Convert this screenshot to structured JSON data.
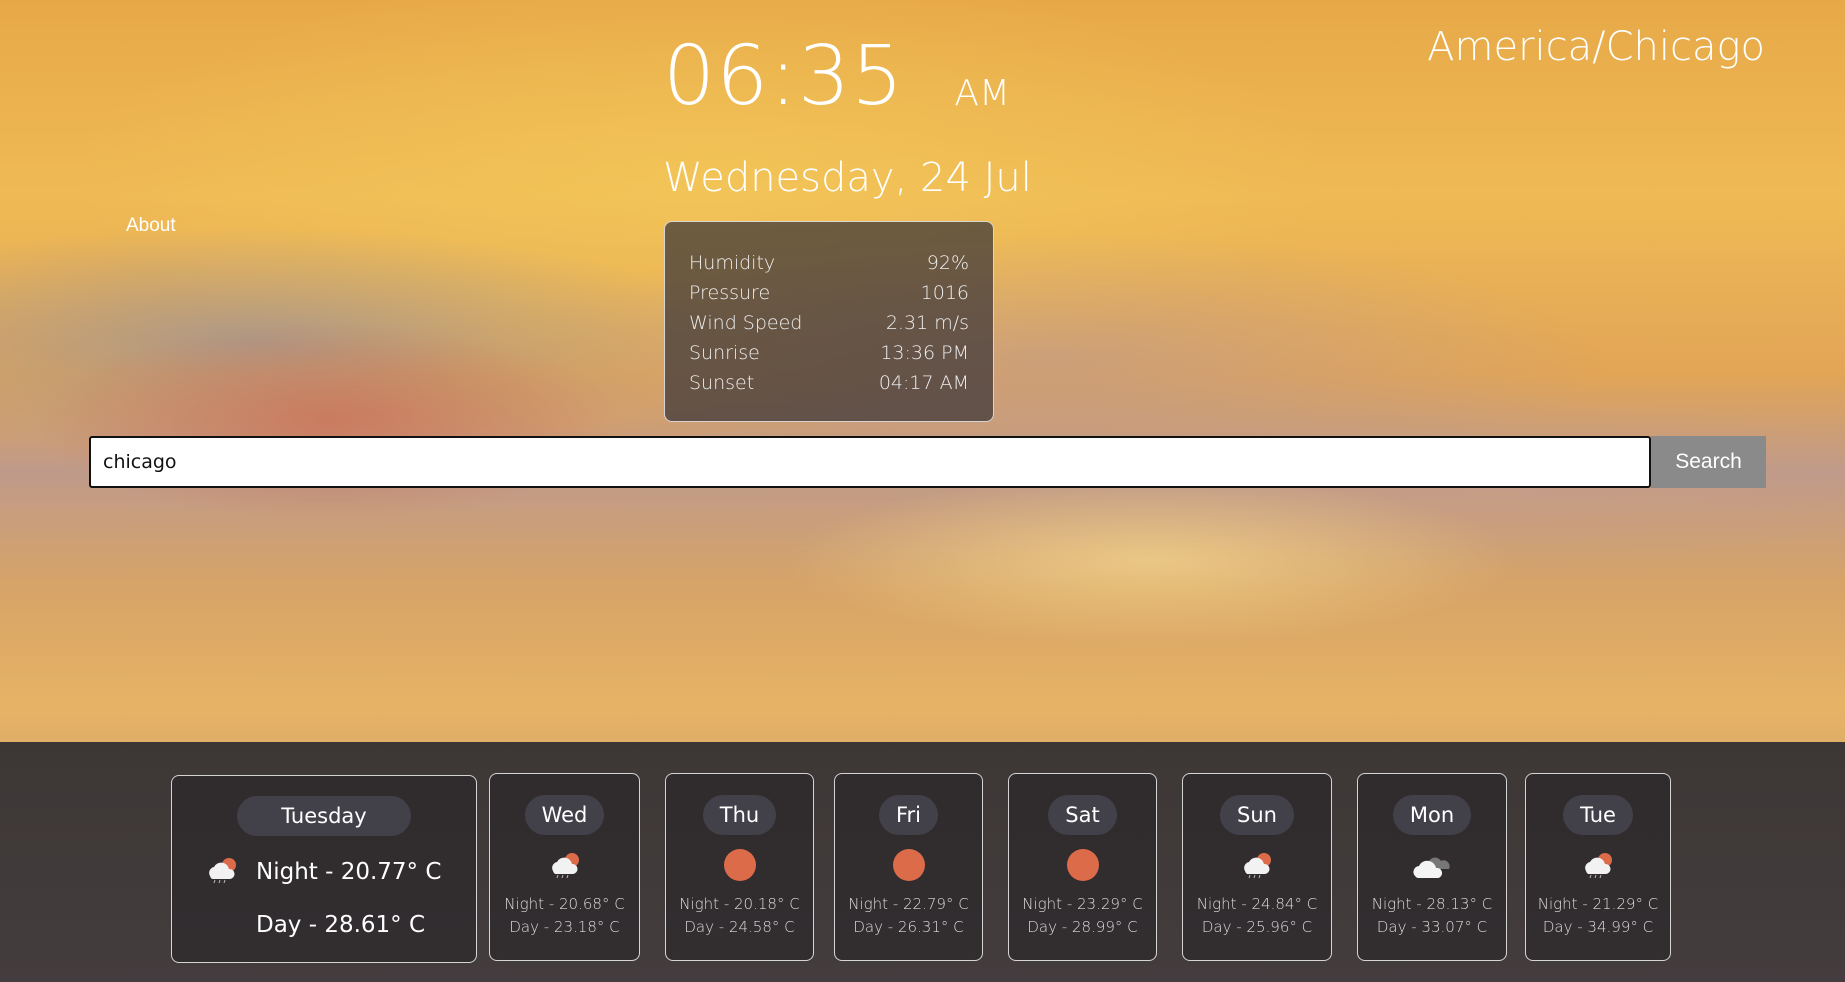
{
  "clock": {
    "time": "06:35",
    "ampm": "AM"
  },
  "date": "Wednesday, 24 Jul",
  "timezone": "America/Chicago",
  "nav": {
    "about": "About"
  },
  "stats": [
    {
      "label": "Humidity",
      "value": "92%"
    },
    {
      "label": "Pressure",
      "value": "1016"
    },
    {
      "label": "Wind Speed",
      "value": "2.31 m/s"
    },
    {
      "label": "Sunrise",
      "value": "13:36 PM"
    },
    {
      "label": "Sunset",
      "value": "04:17 AM"
    }
  ],
  "search": {
    "value": "chicago",
    "button": "Search"
  },
  "colors": {
    "sun": "#dc6b4a",
    "pill": "#42414a",
    "search_button": "#8a8a8a"
  },
  "today": {
    "day": "Tuesday",
    "icon": "cloud-sun-rain-icon",
    "night": "Night - 20.77° C",
    "day_temp": "Day - 28.61° C"
  },
  "forecast": [
    {
      "day": "Wed",
      "icon": "cloud-sun-rain-icon",
      "night": "Night - 20.68° C",
      "day_temp": "Day - 23.18° C"
    },
    {
      "day": "Thu",
      "icon": "sun-icon",
      "night": "Night - 20.18° C",
      "day_temp": "Day - 24.58° C"
    },
    {
      "day": "Fri",
      "icon": "sun-icon",
      "night": "Night - 22.79° C",
      "day_temp": "Day - 26.31° C"
    },
    {
      "day": "Sat",
      "icon": "sun-icon",
      "night": "Night - 23.29° C",
      "day_temp": "Day - 28.99° C"
    },
    {
      "day": "Sun",
      "icon": "cloud-sun-rain-icon",
      "night": "Night - 24.84° C",
      "day_temp": "Day - 25.96° C"
    },
    {
      "day": "Mon",
      "icon": "clouds-icon",
      "night": "Night - 28.13° C",
      "day_temp": "Day - 33.07° C"
    },
    {
      "day": "Tue",
      "icon": "cloud-sun-rain-icon",
      "night": "Night - 21.29° C",
      "day_temp": "Day - 34.99° C"
    }
  ]
}
